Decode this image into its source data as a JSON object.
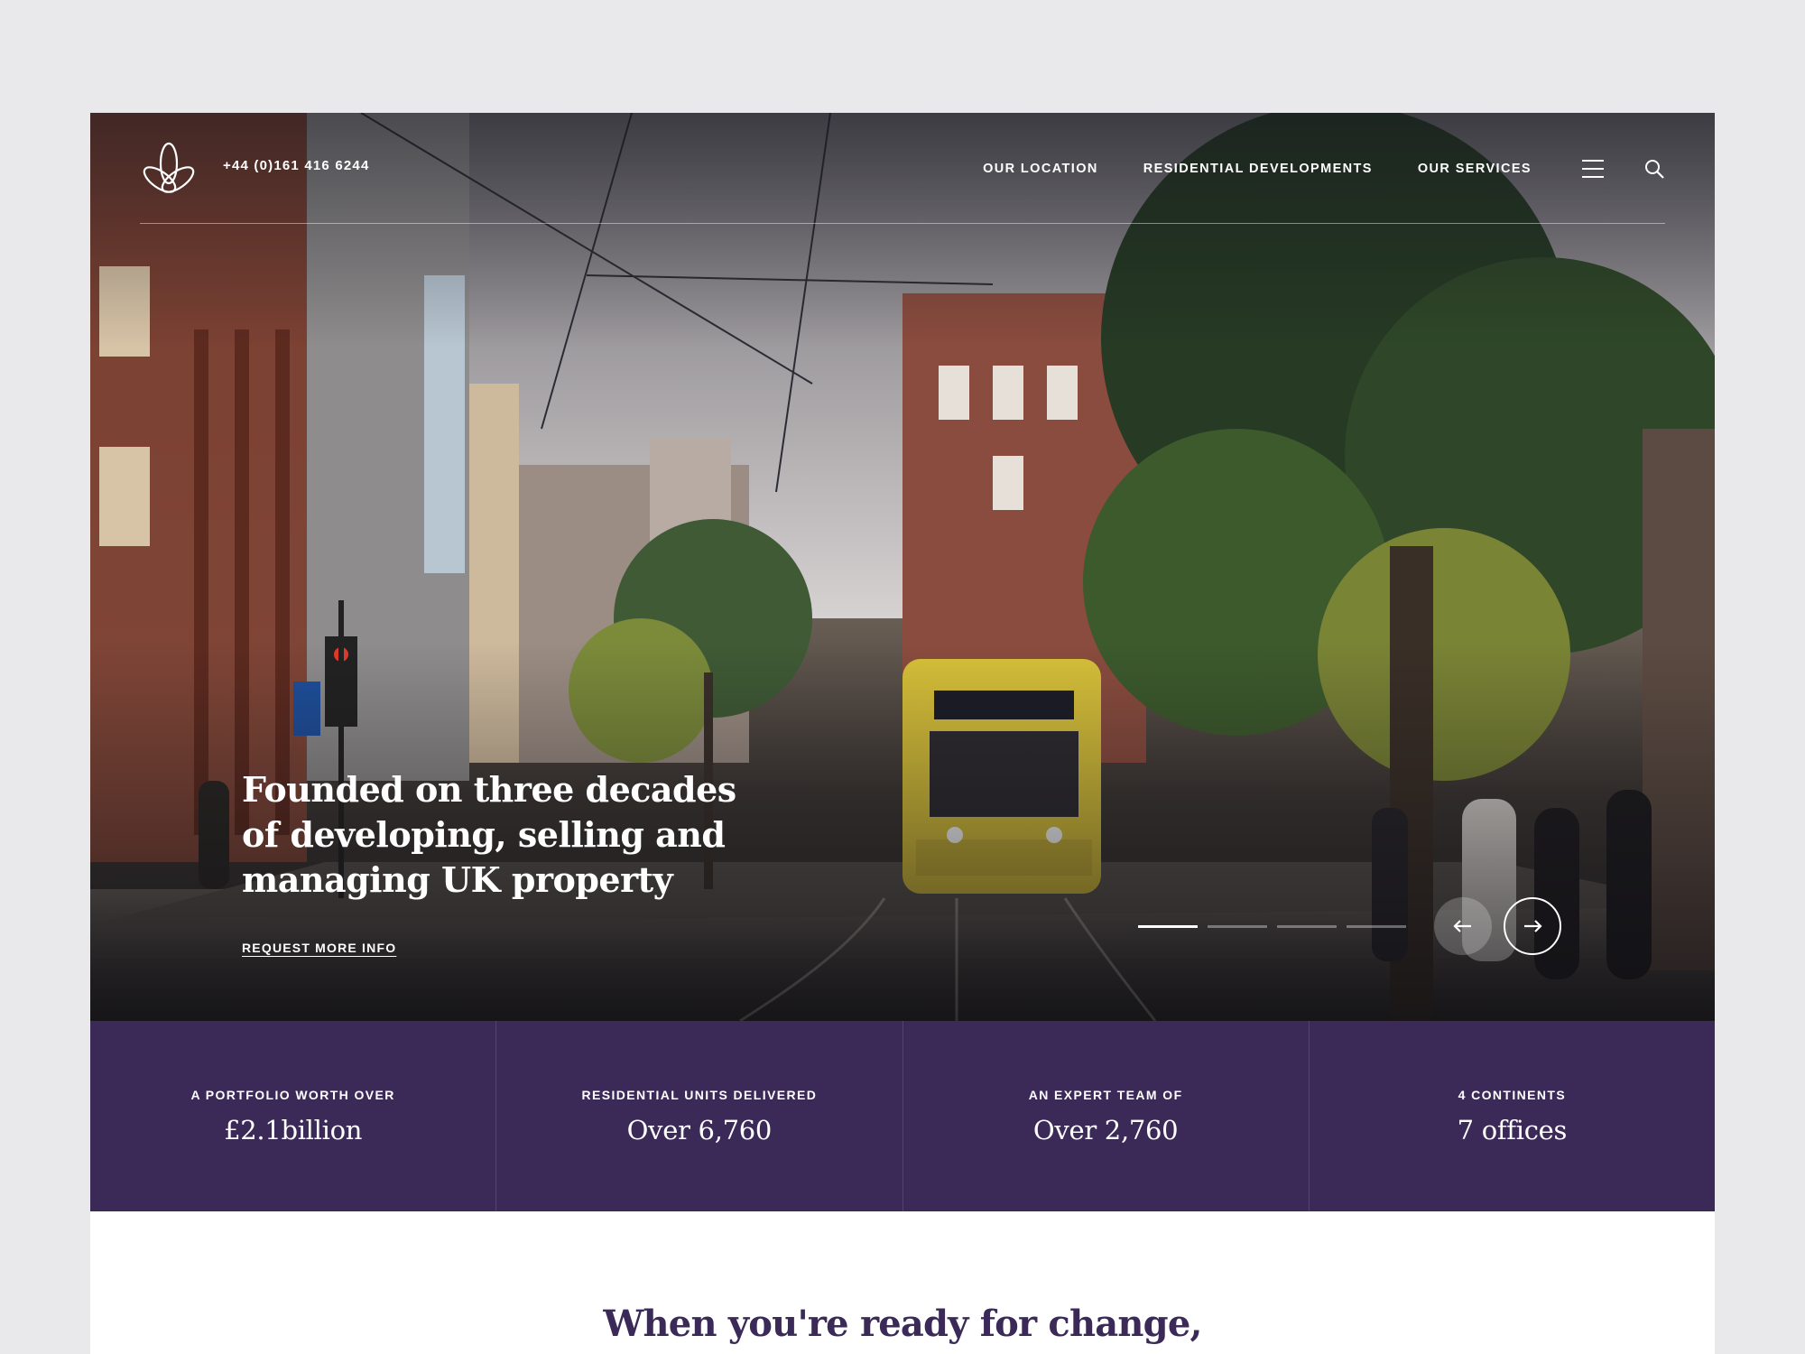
{
  "header": {
    "phone": "+44 (0)161 416 6244",
    "nav": [
      "OUR LOCATION",
      "RESIDENTIAL DEVELOPMENTS",
      "OUR SERVICES"
    ],
    "icons": [
      "logo-icon",
      "menu-icon",
      "search-icon"
    ]
  },
  "hero": {
    "headline": "Founded on three decades of developing, selling and managing UK property",
    "cta": "REQUEST MORE INFO",
    "slides_total": 4,
    "slide_active": 1
  },
  "stats": [
    {
      "label": "A PORTFOLIO WORTH OVER",
      "value": "£2.1billion"
    },
    {
      "label": "RESIDENTIAL UNITS DELIVERED",
      "value": "Over 6,760"
    },
    {
      "label": "AN EXPERT TEAM OF",
      "value": "Over 2,760"
    },
    {
      "label": "4 CONTINENTS",
      "value": "7 offices"
    }
  ],
  "intro": {
    "heading": "When you're ready for change,"
  },
  "colors": {
    "brand_purple": "#3b2a58",
    "page_bg": "#e9e8ea",
    "tram_yellow": "#d9c23a"
  }
}
